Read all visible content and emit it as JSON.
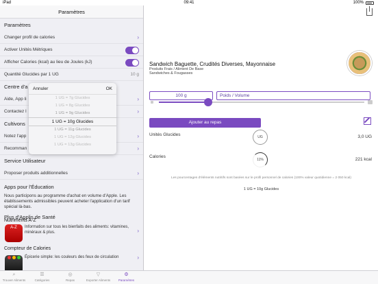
{
  "status": {
    "carrier": "iPad",
    "time": "09:41",
    "battery": "100%"
  },
  "left": {
    "nav_title": "Paramètres",
    "sec_params": "Paramètres",
    "rows": {
      "change_profile": "Changer profil de calories",
      "metric": "Activer Unités Métriques",
      "kcal": "Afficher Calories (kcal) au lieu de Joules (kJ)",
      "quantity": "Quantité Glucides par 1 UG",
      "quantity_value": "10 g"
    },
    "sec_centre": "Centre d'a",
    "help": "Aide, App li",
    "contact": "Contactez l",
    "sec_cultivons": "Cultivons",
    "rate": "Notez l'app",
    "recommend": "Recomman",
    "sec_service": "Service Utilisateur",
    "propose": "Proposer produits additionnelles",
    "sec_education": "Apps pour l'Éducation",
    "education_text": "Nous participons au programme d'achat en volume d'Apple. Les établissements admissibles peuvent acheter l'application d'un tarif spécial là-bas.",
    "sec_more": "Plus d'Applis de Santé",
    "app1_title": "Nutriments A-Z",
    "app1_desc": "Information sur tous les bienfaits des aliments: vitamines, minéraux & plus.",
    "app1_icon_text": "A-Z",
    "app2_title": "Compteur de Calories",
    "app2_desc": "Épicerie simple: les couleurs des feux de circulation"
  },
  "picker": {
    "cancel": "Annuler",
    "ok": "OK",
    "items": [
      "1 UG = 7g Glucides",
      "1 UG = 8g Glucides",
      "1 UG = 9g Glucides",
      "1 UG = 10g Glucides",
      "1 UG = 11g Glucides",
      "1 UG = 12g Glucides",
      "1 UG = 13g Glucides"
    ],
    "selected_index": 3
  },
  "right": {
    "food_name": "Sandwich Baguette, Crudités Diverses, Mayonnaise",
    "food_sub1": "Produits Frais / Aliment De Base",
    "food_sub2": "Sandwiches & Fougasses",
    "amount": "100 g",
    "unit": "Poids / Volume",
    "slider_fraction": 0.24,
    "add_button": "Ajouter au repas",
    "ug_label": "Unités Glucides",
    "ug_ring": "UG",
    "ug_value": "3,0 UG",
    "cal_label": "Calories",
    "cal_ring": "11%",
    "cal_value": "221 kcal",
    "note": "Les pourcentages d'éléments nutritifs sont basées sur le profil personnel de calories (100% valeur quotidienne = 2 050 kcal)",
    "conversion": "1 UG = 10g Glucides"
  },
  "tabs": [
    {
      "label": "Trouver Aliments",
      "icon": "search-icon",
      "glyph": "⌕"
    },
    {
      "label": "Catégories",
      "icon": "list-icon",
      "glyph": "☰"
    },
    {
      "label": "Repas",
      "icon": "meal-icon",
      "glyph": "◎"
    },
    {
      "label": "Exporter Aliments",
      "icon": "filter-icon",
      "glyph": "▽"
    },
    {
      "label": "Paramètres",
      "icon": "settings-icon",
      "glyph": "⚙"
    }
  ],
  "accent": "#7a4ac0"
}
